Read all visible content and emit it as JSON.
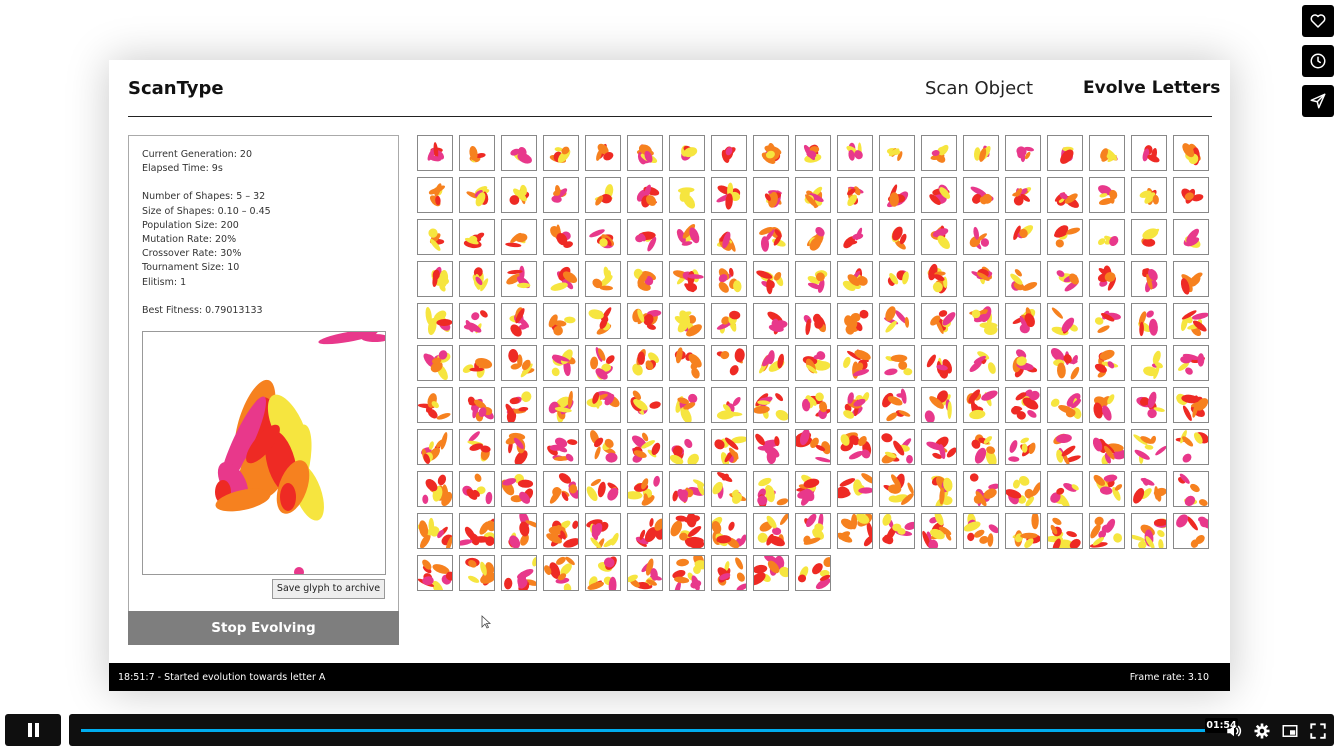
{
  "app": {
    "title": "ScanType"
  },
  "nav": {
    "scan_object": "Scan Object",
    "evolve_letters": "Evolve Letters"
  },
  "stats": {
    "current_generation": "Current Generation: 20",
    "elapsed_time": "Elapsed Time: 9s",
    "number_of_shapes": "Number of Shapes: 5 – 32",
    "size_of_shapes": "Size of Shapes: 0.10 – 0.45",
    "population_size": "Population Size: 200",
    "mutation_rate": "Mutation Rate: 20%",
    "crossover_rate": "Crossover Rate: 30%",
    "tournament_size": "Tournament Size: 10",
    "elitism": "Elitism: 1",
    "best_fitness": "Best Fitness: 0.79013133"
  },
  "buttons": {
    "save_glyph": "Save glyph to archive",
    "stop_evolving": "Stop Evolving"
  },
  "status": {
    "message": "18:51:7 - Started evolution towards letter A",
    "frame_rate": "Frame rate: 3.10"
  },
  "population_grid": {
    "columns": 19,
    "rows": 11,
    "visible_count": 200
  },
  "player": {
    "current_time": "01:54",
    "progress": 0.998
  },
  "colors": {
    "red": "#ee2a24",
    "orange": "#f6811f",
    "pink": "#e8388b",
    "yellow": "#f6e53f",
    "status_bar": "#000000",
    "stop_button": "#7e7e7e",
    "progress": "#00adef"
  },
  "icons": [
    "heart-icon",
    "clock-icon",
    "send-icon",
    "pause-icon",
    "volume-icon",
    "settings-icon",
    "pip-icon",
    "fullscreen-icon",
    "cursor-icon"
  ]
}
